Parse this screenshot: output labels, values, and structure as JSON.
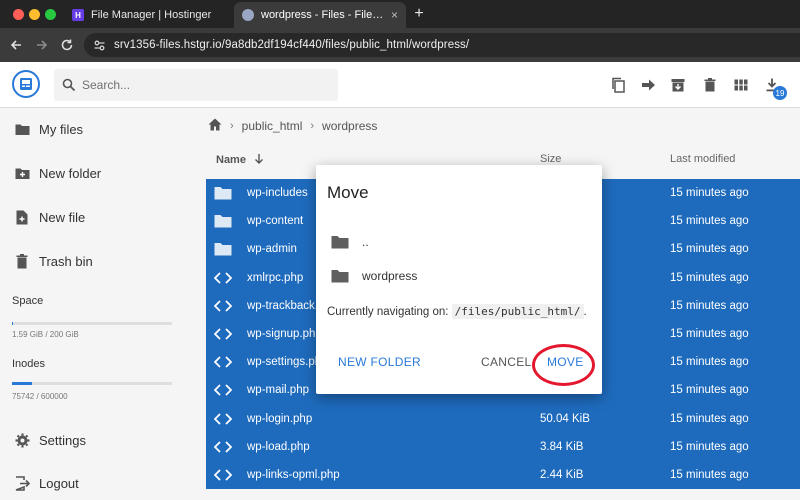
{
  "browser": {
    "tabs": [
      {
        "title": "File Manager | Hostinger",
        "favicon": "hostinger-icon"
      },
      {
        "title": "wordpress - Files - File Browser",
        "favicon": "filebrowser-icon"
      }
    ],
    "new_tab_label": "+",
    "close_glyph": "×",
    "url": "srv1356-files.hstgr.io/9a8db2df194cf440/files/public_html/wordpress/"
  },
  "header": {
    "search_placeholder": "Search...",
    "download_badge": "19",
    "icons": [
      "copy-icon",
      "move-icon",
      "archive-icon",
      "delete-icon",
      "grid-view-icon",
      "download-icon"
    ]
  },
  "sidebar": {
    "items": [
      {
        "label": "My files",
        "icon": "folder-icon"
      },
      {
        "label": "New folder",
        "icon": "new-folder-icon"
      },
      {
        "label": "New file",
        "icon": "new-file-icon"
      },
      {
        "label": "Trash bin",
        "icon": "trash-icon"
      }
    ],
    "space": {
      "label": "Space",
      "usage": "1.59 GiB / 200 GiB",
      "fraction": 0.008
    },
    "inodes": {
      "label": "Inodes",
      "usage": "75742 / 600000",
      "fraction": 0.126
    },
    "settings_label": "Settings",
    "logout_label": "Logout"
  },
  "main": {
    "breadcrumb": [
      "public_html",
      "wordpress"
    ],
    "columns": {
      "name": "Name",
      "size": "Size",
      "modified": "Last modified"
    },
    "rows": [
      {
        "name": "wp-includes",
        "type": "folder",
        "size": "",
        "modified": "15 minutes ago"
      },
      {
        "name": "wp-content",
        "type": "folder",
        "size": "",
        "modified": "15 minutes ago"
      },
      {
        "name": "wp-admin",
        "type": "folder",
        "size": "",
        "modified": "15 minutes ago"
      },
      {
        "name": "xmlrpc.php",
        "type": "code",
        "size": "",
        "modified": "15 minutes ago"
      },
      {
        "name": "wp-trackback.php",
        "type": "code",
        "size": "",
        "modified": "15 minutes ago"
      },
      {
        "name": "wp-signup.php",
        "type": "code",
        "size": "",
        "modified": "15 minutes ago"
      },
      {
        "name": "wp-settings.php",
        "type": "code",
        "size": "",
        "modified": "15 minutes ago"
      },
      {
        "name": "wp-mail.php",
        "type": "code",
        "size": "",
        "modified": "15 minutes ago"
      },
      {
        "name": "wp-login.php",
        "type": "code",
        "size": "50.04 KiB",
        "modified": "15 minutes ago"
      },
      {
        "name": "wp-load.php",
        "type": "code",
        "size": "3.84 KiB",
        "modified": "15 minutes ago"
      },
      {
        "name": "wp-links-opml.php",
        "type": "code",
        "size": "2.44 KiB",
        "modified": "15 minutes ago"
      }
    ]
  },
  "dialog": {
    "title": "Move",
    "items": [
      {
        "label": ".."
      },
      {
        "label": "wordpress"
      }
    ],
    "nav_prefix": "Currently navigating on:",
    "nav_path": "/files/public_html/",
    "nav_suffix": ".",
    "new_folder_label": "NEW FOLDER",
    "cancel_label": "CANCEL",
    "move_label": "MOVE"
  },
  "colors": {
    "accent": "#2979d9",
    "selection": "#1e6bbd",
    "annotation": "#e3172e"
  }
}
